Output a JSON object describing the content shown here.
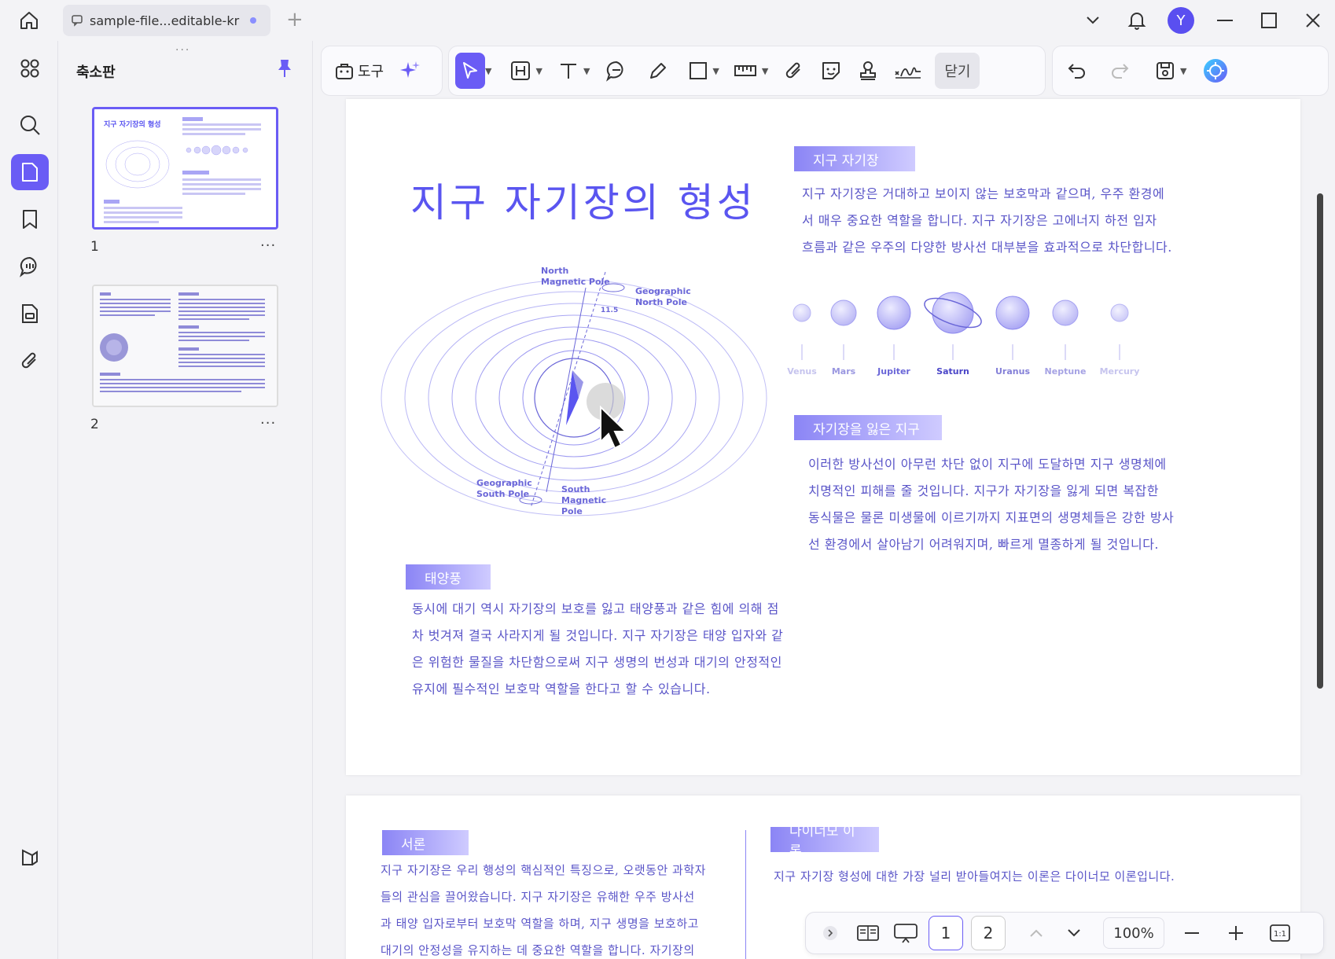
{
  "titlebar": {
    "tab_title": "sample-file...editable-kr",
    "avatar_letter": "Y",
    "new_tab": "+"
  },
  "sidebar": {
    "panel_title": "축소판",
    "thumbnails": [
      {
        "page": "1",
        "more": "···"
      },
      {
        "page": "2",
        "more": "···"
      }
    ]
  },
  "toolbar": {
    "tools_label": "도구",
    "close_label": "닫기"
  },
  "document": {
    "title": "지구 자기장의 형성",
    "sections": {
      "earth_field": {
        "label": "지구 자기장",
        "lines": [
          "지구 자기장은 거대하고 보이지 않는 보호막과 같으며, 우주 환경에",
          "서 매우 중요한 역할을 합니다. 지구 자기장은 고에너지 하전 입자",
          "흐름과 같은 우주의 다양한 방사선 대부분을 효과적으로 차단합니다."
        ]
      },
      "lost_field": {
        "label": "자기장을 잃은 지구",
        "lines": [
          "이러한 방사선이 아무런 차단 없이 지구에 도달하면 지구 생명체에",
          "치명적인 피해를 줄 것입니다. 지구가 자기장을 잃게 되면 복잡한",
          "동식물은 물론 미생물에 이르기까지 지표면의 생명체들은 강한 방사",
          "선 환경에서 살아남기 어려워지며, 빠르게 멸종하게 될 것입니다."
        ]
      },
      "solar_wind": {
        "label": "태양풍",
        "lines": [
          "동시에 대기 역시 자기장의 보호를 잃고 태양풍과 같은 힘에 의해 점",
          "차 벗겨져 결국 사라지게 될 것입니다. 지구 자기장은 태양 입자와 같",
          "은 위험한 물질을 차단함으로써 지구 생명의 번성과 대기의 안정적인",
          "유지에 필수적인 보호막 역할을 한다고 할 수 있습니다."
        ]
      },
      "intro": {
        "label": "서론",
        "lines": [
          "지구 자기장은 우리 행성의 핵심적인 특징으로, 오랫동안 과학자",
          "들의 관심을 끌어왔습니다. 지구 자기장은 유해한 우주 방사선",
          "과 태양 입자로부터 보호막 역할을 하며, 지구 생명을 보호하고",
          "대기의 안정성을 유지하는 데 중요한 역할을 합니다. 자기장의"
        ]
      },
      "dynamo": {
        "label": "다이너모 이론",
        "lines": [
          "지구 자기장 형성에 대한 가장 널리 받아들여지는 이론은 다이너모 이론입니다."
        ]
      }
    },
    "diagram_labels": {
      "north_magnetic": "North\nMagnetic Pole",
      "geographic_north": "Geographic\nNorth Pole",
      "geographic_south": "Geographic\nSouth Pole",
      "south_magnetic": "South\nMagnetic\nPole",
      "tilt": "11.5"
    },
    "planets": [
      "Venus",
      "Mars",
      "Jupiter",
      "Saturn",
      "Uranus",
      "Neptune",
      "Mercury"
    ]
  },
  "navbar": {
    "page1": "1",
    "page2": "2",
    "zoom": "100%"
  },
  "colors": {
    "accent": "#6a5cf5",
    "doc_text": "#5a55c8"
  }
}
